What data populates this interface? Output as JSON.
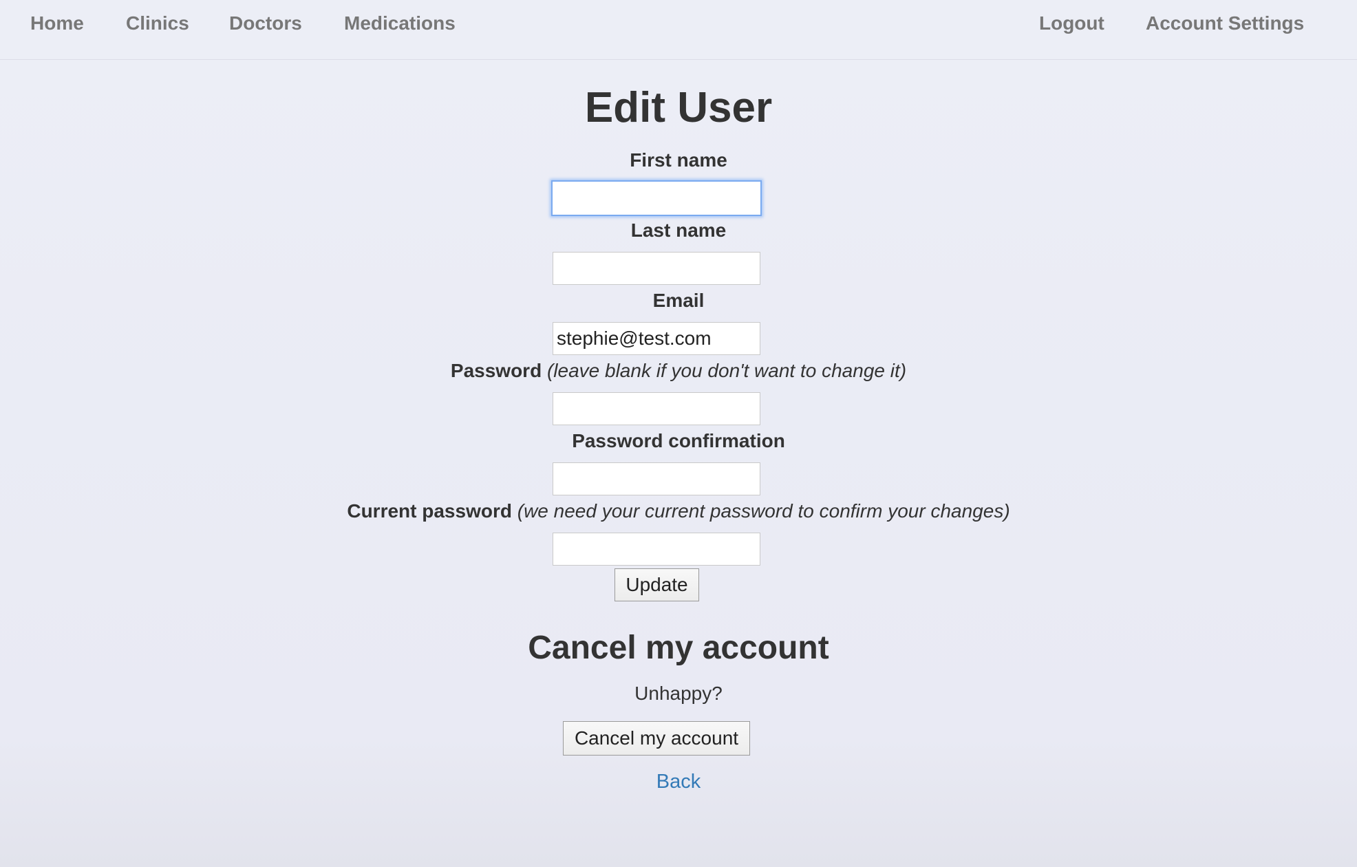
{
  "nav": {
    "left": [
      "Home",
      "Clinics",
      "Doctors",
      "Medications"
    ],
    "right": [
      "Logout",
      "Account Settings"
    ]
  },
  "form": {
    "title": "Edit User",
    "first_name": {
      "label": "First name",
      "value": ""
    },
    "last_name": {
      "label": "Last name",
      "value": ""
    },
    "email": {
      "label": "Email",
      "value": "stephie@test.com"
    },
    "password": {
      "label": "Password",
      "hint": "(leave blank if you don't want to change it)",
      "value": ""
    },
    "password_confirmation": {
      "label": "Password confirmation",
      "value": ""
    },
    "current_password": {
      "label": "Current password",
      "hint": "(we need your current password to confirm your changes)",
      "value": ""
    },
    "submit_label": "Update"
  },
  "cancel": {
    "title": "Cancel my account",
    "prompt": "Unhappy?",
    "button_label": "Cancel my account"
  },
  "back_link": "Back",
  "colors": {
    "background": "#eaebf5",
    "nav_text": "#777777",
    "link": "#337ab7",
    "focus_ring": "#7aaaf0"
  }
}
